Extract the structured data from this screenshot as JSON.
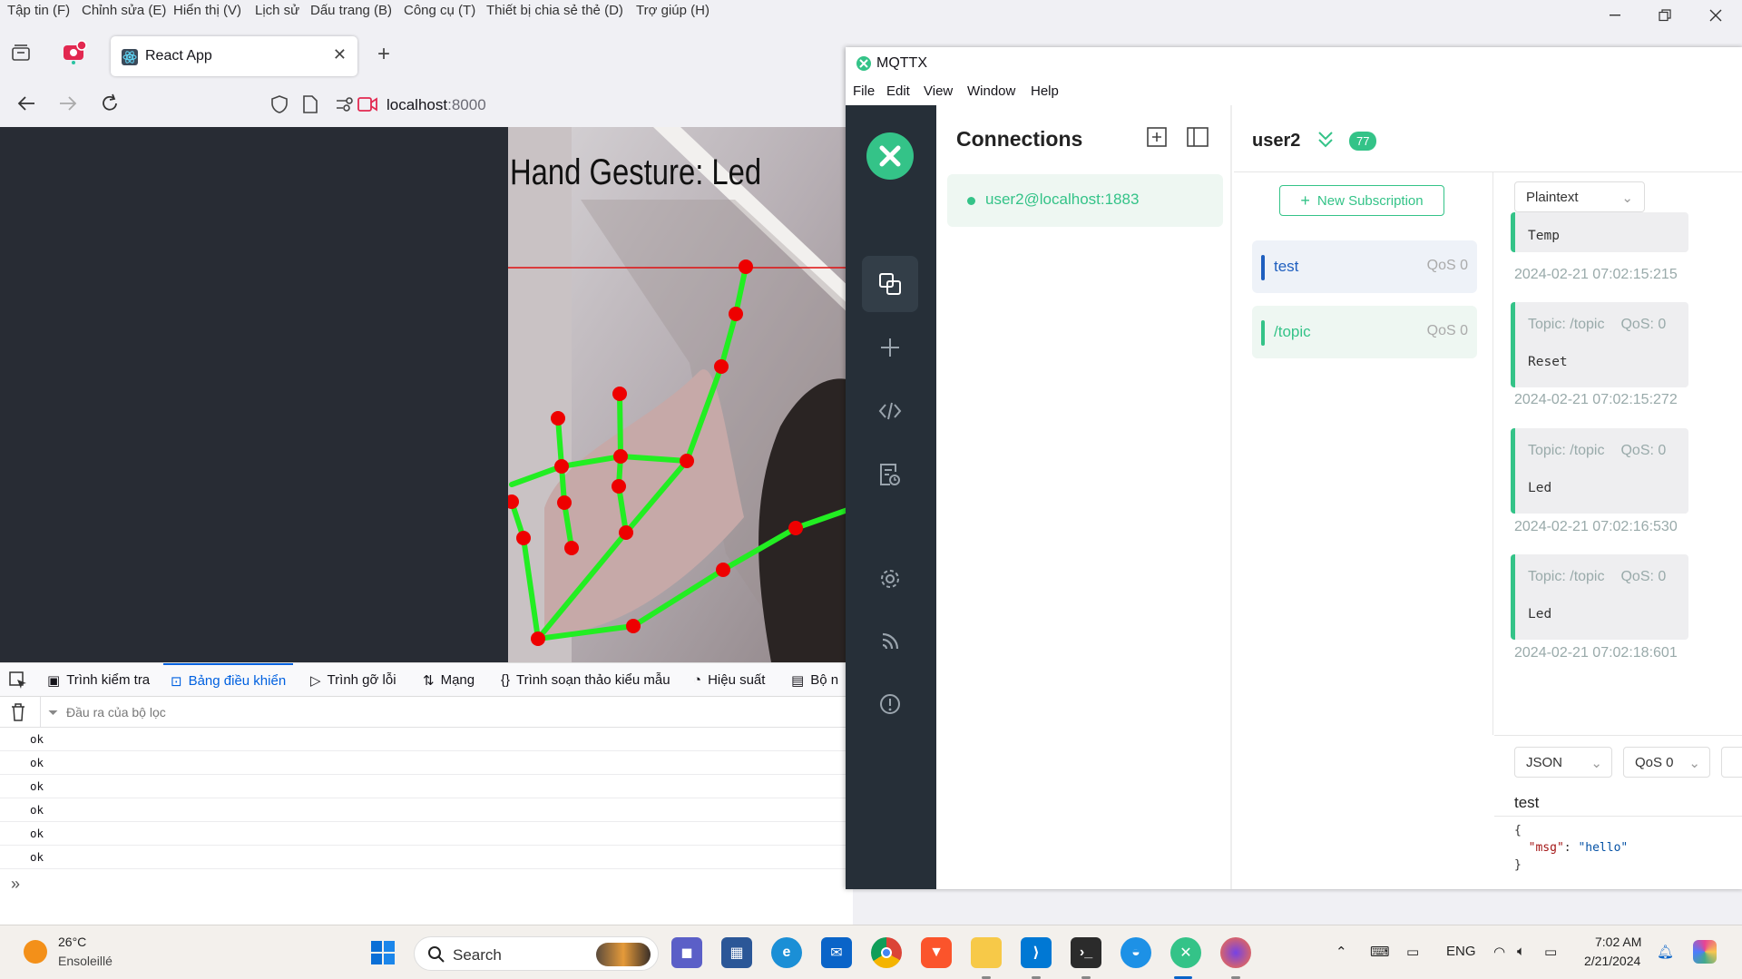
{
  "firefox": {
    "menus": [
      "Tập tin (F)",
      "Chỉnh sửa (E)",
      "Hiển thị (V)",
      "Lịch sử",
      "Dấu trang (B)",
      "Công cụ (T)",
      "Thiết bị chia sẻ thẻ (D)",
      "Trợ giúp (H)"
    ],
    "tab_title": "React App",
    "url_host": "localhost",
    "url_port": ":8000",
    "video_overlay_text": "Hand Gesture: Led",
    "devtools_tabs": [
      "Trình kiểm tra",
      "Bảng điều khiển",
      "Trình gỡ lỗi",
      "Mạng",
      "Trình soạn thảo kiểu mẫu",
      "Hiệu suất",
      "Bộ n"
    ],
    "devtools_active_tab": "Bảng điều khiển",
    "filter_placeholder": "Đầu ra của bộ lọc",
    "console_logs": [
      "ok",
      "ok",
      "ok",
      "ok",
      "ok",
      "ok"
    ]
  },
  "mqttx": {
    "window_title": "MQTTX",
    "menus": [
      "File",
      "Edit",
      "View",
      "Window",
      "Help"
    ],
    "connections_title": "Connections",
    "connection_name": "user2@localhost:1883",
    "active_connection": "user2",
    "unread_badge": "77",
    "new_subscription_label": "New Subscription",
    "subscriptions": [
      {
        "topic": "test",
        "qos": "QoS 0",
        "color": "#1f5fbf"
      },
      {
        "topic": "/topic",
        "qos": "QoS 0",
        "color": "#34c388"
      }
    ],
    "payload_format": "Plaintext",
    "messages": [
      {
        "topic": "",
        "qos": "",
        "payload": "Temp",
        "time": "2024-02-21 07:02:15:215"
      },
      {
        "topic": "Topic: /topic",
        "qos": "QoS: 0",
        "payload": "Reset",
        "time": "2024-02-21 07:02:15:272"
      },
      {
        "topic": "Topic: /topic",
        "qos": "QoS: 0",
        "payload": "Led",
        "time": "2024-02-21 07:02:16:530"
      },
      {
        "topic": "Topic: /topic",
        "qos": "QoS: 0",
        "payload": "Led",
        "time": "2024-02-21 07:02:18:601"
      }
    ],
    "compose": {
      "format": "JSON",
      "qos": "QoS 0",
      "topic": "test",
      "body_open": "{",
      "body_key": "\"msg\"",
      "body_value": "\"hello\"",
      "body_close": "}"
    },
    "accent_color": "#34c388"
  },
  "taskbar": {
    "weather_temp": "26°C",
    "weather_desc": "Ensoleillé",
    "search_label": "Search",
    "language": "ENG",
    "time": "7:02 AM",
    "date": "2/21/2024"
  }
}
